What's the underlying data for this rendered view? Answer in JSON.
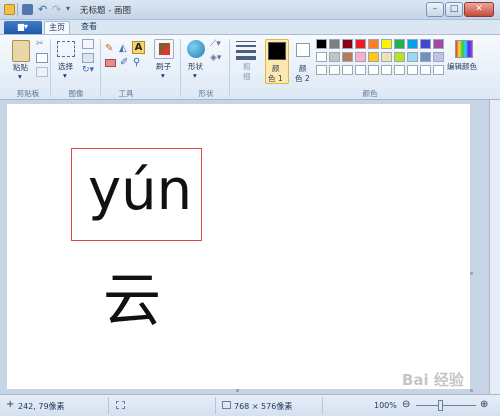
{
  "window": {
    "title": "无标题 - 画图",
    "minimize": "–",
    "maximize": "□",
    "close": "✕"
  },
  "tabs": {
    "app_menu": "▆▾",
    "home": "主页",
    "view": "查看"
  },
  "ribbon": {
    "clipboard": {
      "paste": "粘贴",
      "group": "剪贴板"
    },
    "image": {
      "select": "选择",
      "group": "图像"
    },
    "tools": {
      "group": "工具",
      "text_tool": "A"
    },
    "brushes": {
      "label": "刷子"
    },
    "shapes": {
      "label": "形状",
      "group": "形状"
    },
    "size": {
      "label1": "粗",
      "label2": "细"
    },
    "colors": {
      "color1": "颜\n色 1",
      "color1_a": "颜",
      "color1_b": "色 1",
      "color2_a": "颜",
      "color2_b": "色 2",
      "edit_colors": "编辑颜色",
      "group": "颜色",
      "color1_value": "#000000",
      "color2_value": "#ffffff"
    },
    "palette_row1": [
      "#000000",
      "#7f7f7f",
      "#880015",
      "#ed1c24",
      "#ff7f27",
      "#fff200",
      "#22b14c",
      "#00a2e8",
      "#3f48cc",
      "#a349a4"
    ],
    "palette_row2": [
      "#ffffff",
      "#c3c3c3",
      "#b97a57",
      "#ffaec9",
      "#ffc90e",
      "#efe4b0",
      "#b5e61d",
      "#99d9ea",
      "#7092be",
      "#c8bfe7"
    ]
  },
  "canvas": {
    "pinyin": "yún",
    "hanzi": "云",
    "box_color": "#d9494c"
  },
  "status": {
    "cursor_pos": "242, 79像素",
    "dimensions": "768 × 576像素",
    "zoom": "100%",
    "zoom_out": "⊖",
    "zoom_in": "⊕"
  },
  "watermark": "Bai 经验"
}
